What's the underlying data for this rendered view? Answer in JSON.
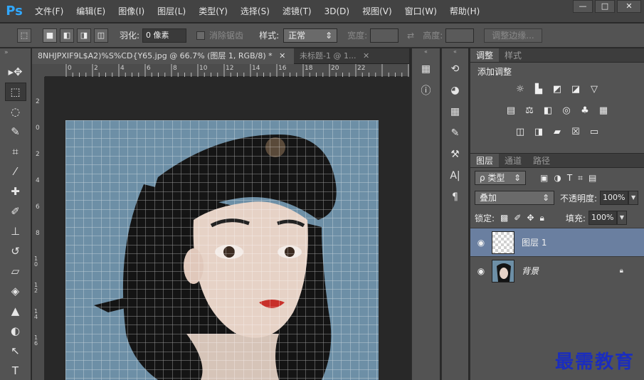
{
  "app": {
    "logo": "Ps"
  },
  "menu": [
    "文件(F)",
    "编辑(E)",
    "图像(I)",
    "图层(L)",
    "类型(Y)",
    "选择(S)",
    "滤镜(T)",
    "3D(D)",
    "视图(V)",
    "窗口(W)",
    "帮助(H)"
  ],
  "window_controls": {
    "minimize": "—",
    "maximize": "□",
    "close": "✕"
  },
  "options": {
    "feather_label": "羽化:",
    "feather_value": "0 像素",
    "antialias_label": "消除锯齿",
    "style_label": "样式:",
    "style_value": "正常",
    "width_label": "宽度:",
    "height_label": "高度:",
    "refine_button": "调整边缘..."
  },
  "tabs": [
    {
      "label": "8NHJPXIF9L$A2)%S%CD{Y65.jpg @ 66.7% (图层 1, RGB/8) *",
      "close": "✕"
    },
    {
      "label": "未标题-1 @ 1...",
      "close": "✕"
    }
  ],
  "ruler_h": [
    "0",
    "2",
    "4",
    "6",
    "8",
    "10",
    "12",
    "14",
    "16",
    "18",
    "20",
    "22"
  ],
  "ruler_v": [
    "2",
    "0",
    "2",
    "4",
    "6",
    "8",
    "1 0",
    "1 2",
    "1 4",
    "1 6"
  ],
  "adjustments": {
    "tabs": [
      "调整",
      "样式"
    ],
    "title": "添加调整"
  },
  "layers_panel": {
    "tabs": [
      "图层",
      "通道",
      "路径"
    ],
    "filter": "ρ 类型",
    "blend_mode": "叠加",
    "opacity_label": "不透明度:",
    "opacity_value": "100%",
    "lock_label": "锁定:",
    "fill_label": "填充:",
    "fill_value": "100%",
    "layers": [
      {
        "name": "图层 1",
        "selected": true
      },
      {
        "name": "背景",
        "selected": false,
        "locked": true
      }
    ]
  },
  "watermark": "最需教育",
  "colors": {
    "accent": "#31a8ff",
    "selected_layer": "#6a7fa0",
    "canvas_bg": "#6d8fa6",
    "watermark": "#1b2dbd"
  }
}
